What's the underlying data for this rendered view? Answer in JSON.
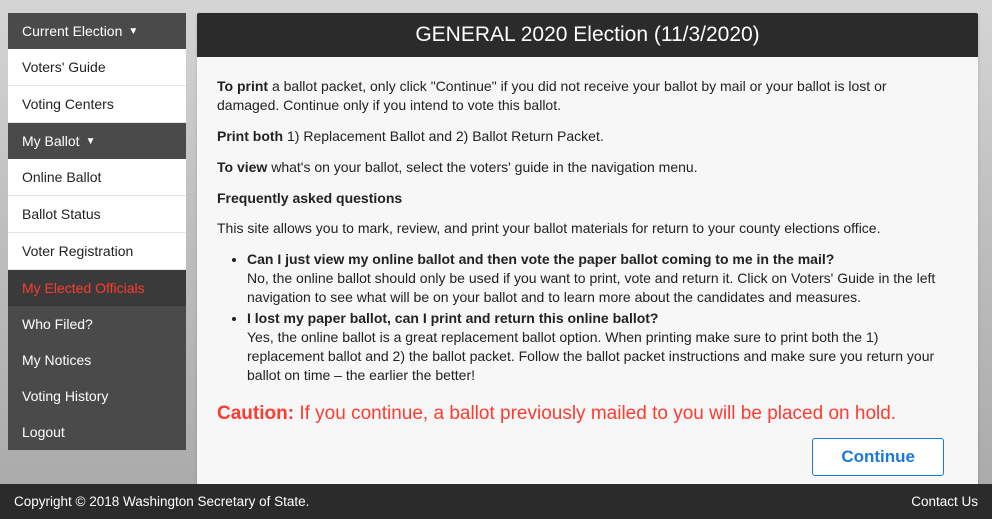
{
  "sidebar": {
    "header": "Current Election",
    "items": [
      {
        "label": "Voters' Guide",
        "style": "light"
      },
      {
        "label": "Voting Centers",
        "style": "light"
      },
      {
        "label": "My Ballot",
        "style": "header",
        "caret": true
      },
      {
        "label": "Online Ballot",
        "style": "light"
      },
      {
        "label": "Ballot Status",
        "style": "light"
      },
      {
        "label": "Voter Registration",
        "style": "light"
      },
      {
        "label": "My Elected Officials",
        "style": "active"
      },
      {
        "label": "Who Filed?",
        "style": "dark"
      },
      {
        "label": "My Notices",
        "style": "dark"
      },
      {
        "label": "Voting History",
        "style": "dark"
      },
      {
        "label": "Logout",
        "style": "dark"
      }
    ]
  },
  "header": {
    "title": "GENERAL 2020 Election (11/3/2020)"
  },
  "body": {
    "p1_strong": "To print",
    "p1_rest": " a ballot packet, only click \"Continue\" if you did not receive your ballot by mail or your ballot is lost or damaged. Continue only if you intend to vote this ballot.",
    "p2_strong": "Print both",
    "p2_rest": " 1) Replacement Ballot and 2) Ballot Return Packet.",
    "p3_strong": "To view",
    "p3_rest": " what's on your ballot, select the voters' guide in the navigation menu.",
    "faq_title": "Frequently asked questions",
    "faq_intro": "This site allows you to mark, review, and print your ballot materials for return to your county elections office.",
    "faq1_q": "Can I just view my online ballot and then vote the paper ballot coming to me in the mail?",
    "faq1_a": "No, the online ballot should only be used if you want to print, vote and return it. Click on Voters' Guide in the left navigation to see what will be on your ballot and to learn more about the candidates and measures.",
    "faq2_q": "I lost my paper ballot, can I print and return this online ballot?",
    "faq2_a": "Yes, the online ballot is a great replacement ballot option. When printing make sure to print both the 1) replacement ballot and 2) the ballot packet. Follow the ballot packet instructions and make sure you return your ballot on time – the earlier the better!",
    "caution_label": "Caution:",
    "caution_text": " If you continue, a ballot previously mailed to you will be placed on hold.",
    "continue_btn": "Continue"
  },
  "footer": {
    "copyright": "Copyright © 2018 Washington Secretary of State.",
    "contact": "Contact Us"
  }
}
